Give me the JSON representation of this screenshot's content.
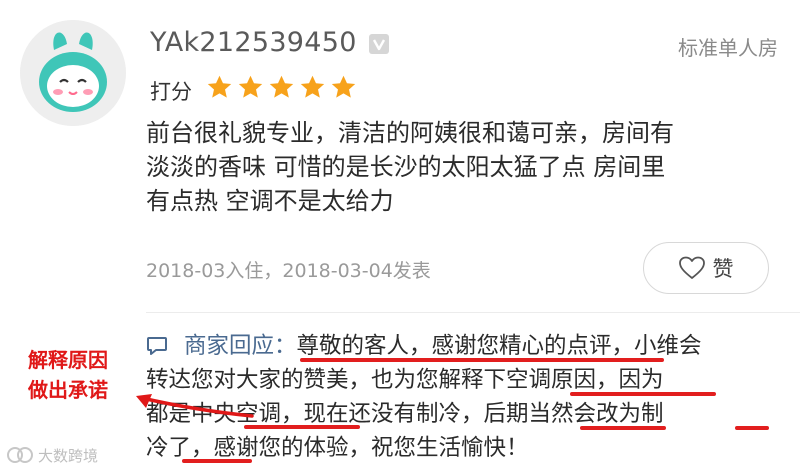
{
  "review": {
    "username": "YAk212539450",
    "room_type": "标准单人房",
    "rating_label": "打分",
    "rating": 5,
    "rating_max": 5,
    "star_color": "#f7a21b",
    "text_lines": [
      "前台很礼貌专业，清洁的阿姨很和蔼可亲，房间有",
      "淡淡的香味 可惜的是长沙的太阳太猛了点 房间里",
      "有点热 空调不是太给力"
    ],
    "stay_dates": "2018-03入住，2018-03-04发表",
    "like_label": "赞"
  },
  "reply": {
    "label": "商家回应：",
    "lines": [
      "尊敬的客人，感谢您精心的点评，小维会",
      "转达您对大家的赞美，也为您解释下空调原因，因为",
      "都是中央空调，现在还没有制冷，后期当然会改为制",
      "冷了，感谢您的体验，祝您生活愉快！"
    ]
  },
  "annotation": {
    "lines": [
      "解释原因",
      "做出承诺"
    ],
    "color": "#e01818"
  },
  "watermark": {
    "text": "大数跨境"
  },
  "colors": {
    "accent_reply": "#4a6a90",
    "text": "#2b2b2b",
    "muted": "#9a9a9a"
  }
}
